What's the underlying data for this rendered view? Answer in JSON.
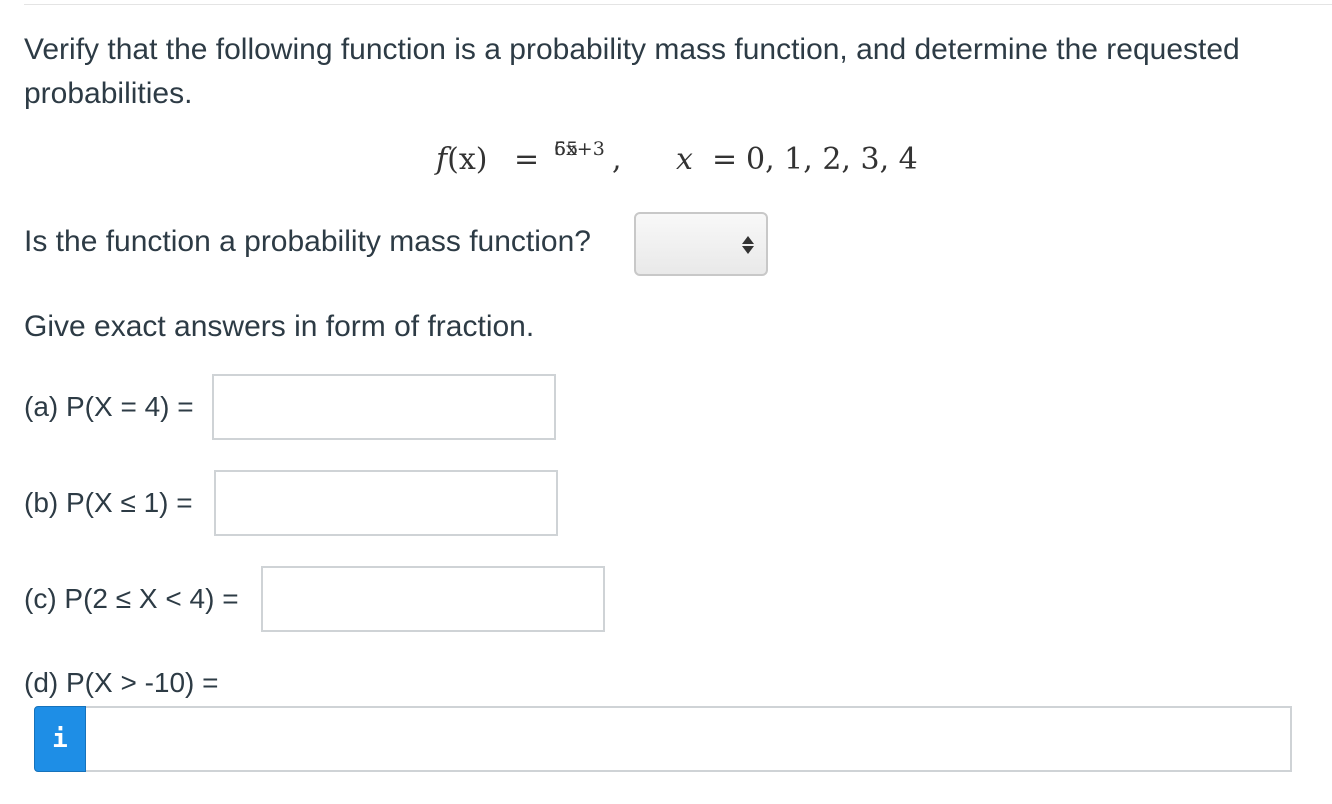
{
  "question": {
    "intro": "Verify that the following function is a probability mass function, and determine the requested probabilities.",
    "formula": {
      "lhs_f": "f",
      "lhs_paren": "(x)",
      "equals": "=",
      "numerator": "5x+3",
      "denominator": "65",
      "comma": ",",
      "var": "x",
      "equals2": "=",
      "domain_values": "0, 1, 2, 3, 4"
    },
    "pmf_question": "Is the function a probability mass function?",
    "pmf_select_value": "",
    "instructions": "Give exact answers in form of fraction."
  },
  "parts": {
    "a": {
      "label": "(a) P(X = 4) =",
      "value": ""
    },
    "b": {
      "label": "(b) P(X ≤ 1) =",
      "value": ""
    },
    "c": {
      "label": "(c) P(2 ≤ X < 4) =",
      "value": ""
    },
    "d": {
      "label": "(d) P(X > -10) =",
      "value": ""
    }
  },
  "info_button": {
    "text": "i"
  },
  "icons": {
    "select_arrows": "up-down-arrows-icon",
    "info": "info-icon"
  }
}
